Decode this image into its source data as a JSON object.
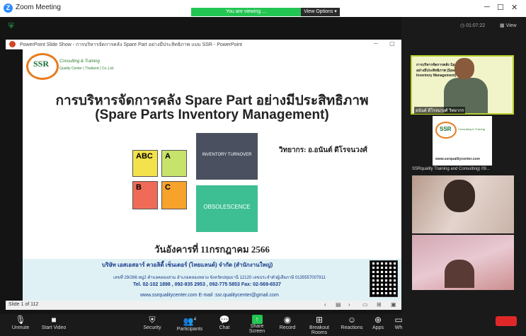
{
  "window": {
    "title": "Zoom Meeting",
    "app_icon": "Z"
  },
  "banner": {
    "viewing": "You are viewing ...",
    "view_options": "View Options"
  },
  "ppt": {
    "bar_title": "PowerPoint Slide Show - การบริหารจัดการคลัง Spare Part อย่างมีประสิทธิภาพ แบบ SSR - PowerPoint",
    "slide_status": "Slide 1 of 112"
  },
  "slide": {
    "logo_ssr": "SSR",
    "logo_tag1": "Consulting & Training",
    "logo_tag2": "Quality Center ( Thailand ) Co.,Ltd.",
    "title_th": "การบริหารจัดการคลัง Spare Part อย่างมีประสิทธิภาพ",
    "title_en": "(Spare Parts Inventory Management)",
    "speaker": "วิทยากร: อ.อนันต์ ดีโรจนวงศ์",
    "card_inventory": "INVENTORY TURNOVER",
    "card_obsolescence": "OBSOLESCENCE",
    "abc": [
      "ABC",
      "A",
      "B",
      "C"
    ],
    "date": "วันอังคารที่ 11กรกฎาคม 2566",
    "footer_company": "บริษัท เอสเอสอาร์ ควอลิตี้ เซ็นเตอร์ (ไทยแลนด์) จำกัด (สำนักงานใหญ่)",
    "footer_address": "เลขที่ 29/266 หมู่2 ตำบลคลองสาม อำเภอคลองหลวง จังหวัดปทุมธานี 12120  เลขประจำตัวผู้เสียภาษี 0135557007911",
    "footer_tel": "Tel. 02-102 1898 , 092-835 2953 , 092-775 5853  Fax: 02-569-6537",
    "footer_web": "www.ssrqualitycenter.com   E-mail :ssr.qualitycenter@gmail.com"
  },
  "right_panel": {
    "timer": "01:07:22",
    "view_label": "View",
    "tile1_name": "อนันต์ ดีโรจนวงศ์ วิทยากร",
    "tile1_slide_text": "การบริหารจัดการคลัง Spare Part อย่างมีประสิทธิภาพ (Spare Parts Inventory Management)",
    "tile2_url": "www.ssrqualitycenter.com",
    "tile2_caption": "SSRquality Training and Consulting) 09..."
  },
  "toolbar": {
    "items": [
      {
        "label": "Unmute",
        "icon": "microphone-muted-icon"
      },
      {
        "label": "Start Video",
        "icon": "video-off-icon"
      },
      {
        "label": "Security",
        "icon": "shield-icon"
      },
      {
        "label": "Participants",
        "icon": "participants-icon",
        "count": "4"
      },
      {
        "label": "Chat",
        "icon": "chat-icon"
      },
      {
        "label": "Share Screen",
        "icon": "share-screen-icon"
      },
      {
        "label": "Record",
        "icon": "record-icon"
      },
      {
        "label": "Breakout Rooms",
        "icon": "breakout-rooms-icon"
      },
      {
        "label": "Reactions",
        "icon": "reactions-icon"
      },
      {
        "label": "Apps",
        "icon": "apps-icon"
      },
      {
        "label": "Wh",
        "icon": "whiteboard-icon"
      }
    ]
  },
  "colors": {
    "zoom_green": "#23c552",
    "accent_blue": "#2d8cff",
    "end_red": "#e02828"
  }
}
